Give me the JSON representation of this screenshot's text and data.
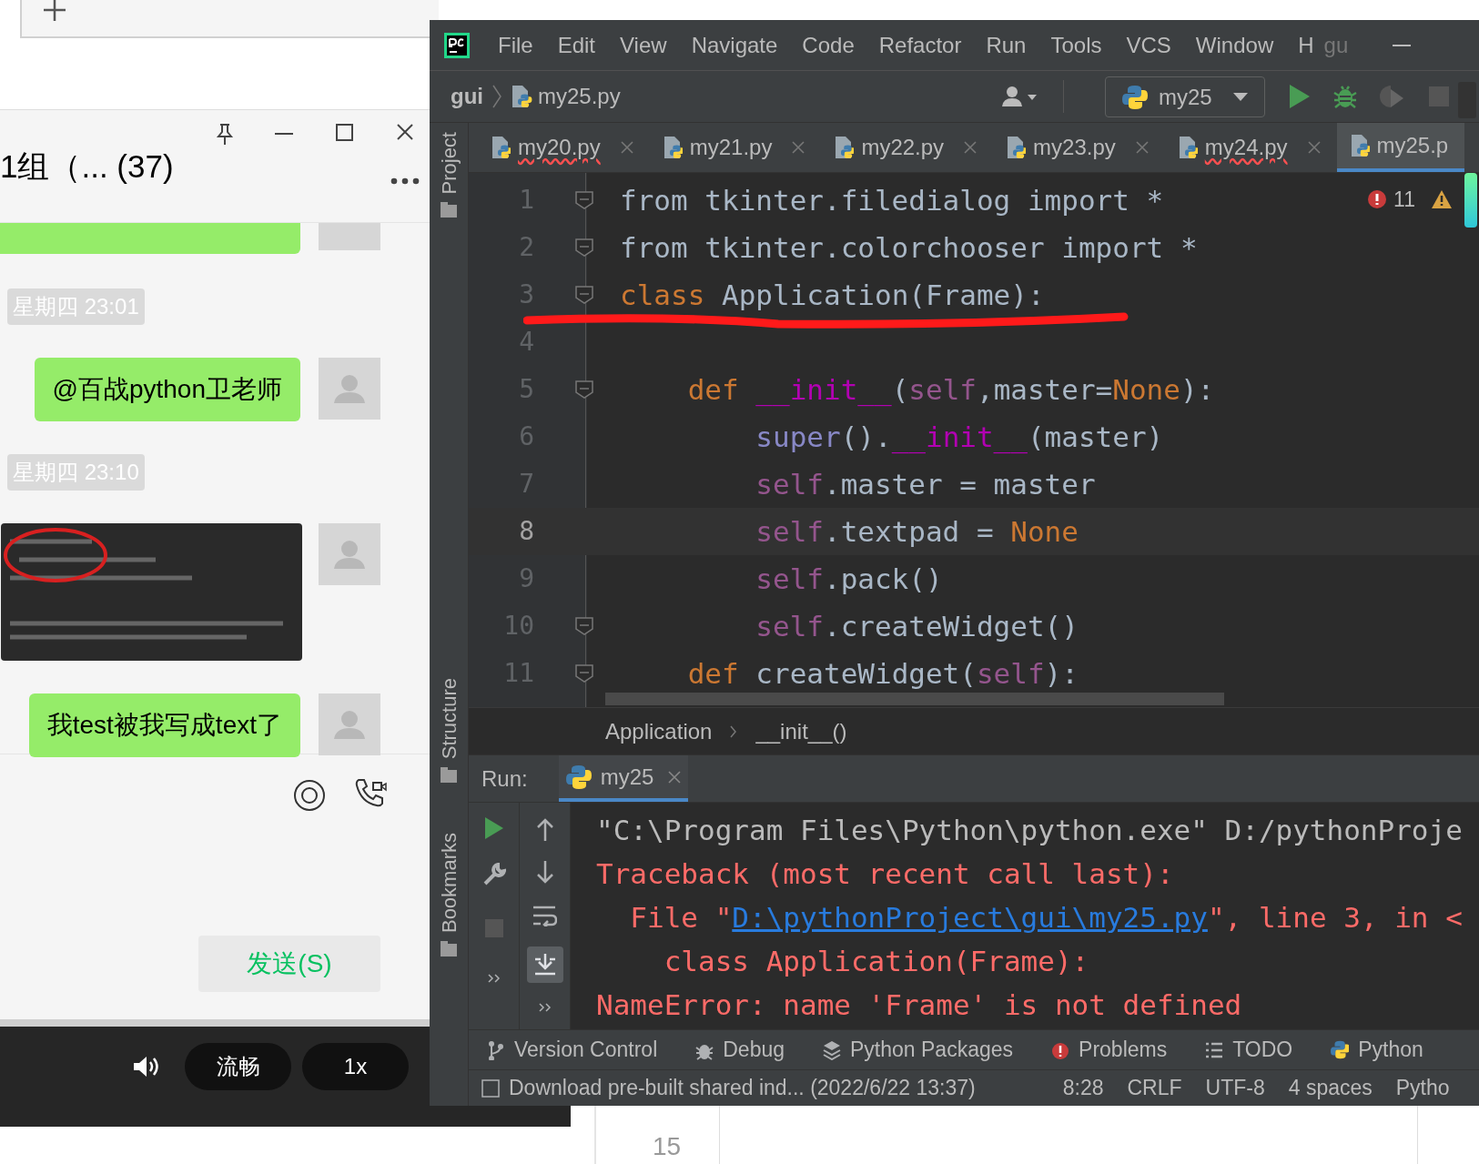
{
  "chat": {
    "title": "1组（... (37)",
    "messages": [
      {
        "kind": "time",
        "text": "星期四 23:01"
      },
      {
        "kind": "text",
        "text": "@百战python卫老师"
      },
      {
        "kind": "time",
        "text": "星期四 23:10"
      },
      {
        "kind": "image"
      },
      {
        "kind": "text",
        "text": "我test被我写成text了"
      }
    ],
    "send_button": "发送(S)"
  },
  "player": {
    "quality": "流畅",
    "speed": "1x"
  },
  "ide": {
    "menu": [
      "File",
      "Edit",
      "View",
      "Navigate",
      "Code",
      "Refactor",
      "Run",
      "Tools",
      "VCS",
      "Window",
      "H"
    ],
    "window_title": "gu",
    "breadcrumb": {
      "project": "gui",
      "file": "my25.py"
    },
    "run_config": "my25",
    "tabs": [
      {
        "label": "my20.py",
        "selected": false,
        "has_error": true
      },
      {
        "label": "my21.py",
        "selected": false,
        "has_error": false
      },
      {
        "label": "my22.py",
        "selected": false,
        "has_error": false
      },
      {
        "label": "my23.py",
        "selected": false,
        "has_error": false
      },
      {
        "label": "my24.py",
        "selected": false,
        "has_error": true
      },
      {
        "label": "my25.p",
        "selected": true,
        "has_error": false
      }
    ],
    "side_tools": [
      "Project",
      "Structure",
      "Bookmarks"
    ],
    "inspections": {
      "errors": "11"
    },
    "code": [
      {
        "number": "1",
        "fold": true,
        "current": false,
        "tokens": [
          {
            "kind": "plain",
            "text": "from tkinter.filedialog import *"
          }
        ]
      },
      {
        "number": "2",
        "fold": true,
        "current": false,
        "tokens": [
          {
            "kind": "plain",
            "text": "from tkinter.colorchooser import *"
          }
        ]
      },
      {
        "number": "3",
        "fold": true,
        "current": false,
        "tokens": [
          {
            "kind": "keyword",
            "text": "class"
          },
          {
            "kind": "plain",
            "text": " Application(Frame):"
          }
        ]
      },
      {
        "number": "4",
        "fold": false,
        "current": false
      },
      {
        "number": "5",
        "fold": true,
        "current": false,
        "tokens": [
          {
            "kind": "keyword",
            "text": "    def"
          },
          {
            "kind": "dunder",
            "text": " __init__"
          },
          {
            "kind": "plain",
            "text": "("
          },
          {
            "kind": "self",
            "text": "self"
          },
          {
            "kind": "plain",
            "text": ",master="
          },
          {
            "kind": "keyword",
            "text": "None"
          },
          {
            "kind": "plain",
            "text": "):"
          }
        ]
      },
      {
        "number": "6",
        "fold": false,
        "current": false,
        "tokens": [
          {
            "kind": "builtin",
            "text": "        super"
          },
          {
            "kind": "plain",
            "text": "()."
          },
          {
            "kind": "dunder",
            "text": "__init__"
          },
          {
            "kind": "plain",
            "text": "(master)"
          }
        ]
      },
      {
        "number": "7",
        "fold": false,
        "current": false,
        "tokens": [
          {
            "kind": "self",
            "text": "        self"
          },
          {
            "kind": "plain",
            "text": ".master = master"
          }
        ]
      },
      {
        "number": "8",
        "fold": false,
        "current": true,
        "tokens": [
          {
            "kind": "self",
            "text": "        self"
          },
          {
            "kind": "plain",
            "text": ".textpad = "
          },
          {
            "kind": "keyword",
            "text": "None"
          }
        ]
      },
      {
        "number": "9",
        "fold": false,
        "current": false,
        "tokens": [
          {
            "kind": "self",
            "text": "        self"
          },
          {
            "kind": "plain",
            "text": ".pack()"
          }
        ]
      },
      {
        "number": "10",
        "fold": true,
        "current": false,
        "tokens": [
          {
            "kind": "self",
            "text": "        self"
          },
          {
            "kind": "plain",
            "text": ".createWidget()"
          }
        ]
      },
      {
        "number": "11",
        "fold": true,
        "current": false,
        "tokens": [
          {
            "kind": "keyword",
            "text": "    def"
          },
          {
            "kind": "plain",
            "text": " createWidget("
          },
          {
            "kind": "self",
            "text": "self"
          },
          {
            "kind": "plain",
            "text": "):"
          }
        ]
      }
    ],
    "structure_path": [
      "Application",
      "__init__()"
    ],
    "run": {
      "label": "Run:",
      "tab": "my25",
      "output": [
        {
          "kind": "command",
          "parts": [
            {
              "kind": "text",
              "text": "\"C:\\Program Files\\Python\\python.exe\" D:/pythonProje"
            }
          ]
        },
        {
          "kind": "error",
          "parts": [
            {
              "kind": "text",
              "text": "Traceback (most recent call last):"
            }
          ]
        },
        {
          "kind": "error",
          "parts": [
            {
              "kind": "text",
              "text": "  File \""
            },
            {
              "kind": "link",
              "text": "D:\\pythonProject\\gui\\my25.py"
            },
            {
              "kind": "text",
              "text": "\", line 3, in <"
            }
          ]
        },
        {
          "kind": "error",
          "parts": [
            {
              "kind": "text",
              "text": "    class Application(Frame):"
            }
          ]
        },
        {
          "kind": "error",
          "parts": [
            {
              "kind": "text",
              "text": "NameError: name 'Frame' is not defined"
            }
          ]
        }
      ]
    },
    "tool_windows": [
      {
        "kind": "vcs",
        "label": "Version Control"
      },
      {
        "kind": "debug",
        "label": "Debug"
      },
      {
        "kind": "packages",
        "label": "Python Packages"
      },
      {
        "kind": "problems",
        "label": "Problems"
      },
      {
        "kind": "todo",
        "label": "TODO"
      },
      {
        "kind": "python",
        "label": "Python"
      }
    ],
    "status": {
      "message": "Download pre-built shared ind... (2022/6/22 13:37)",
      "items": [
        "8:28",
        "CRLF",
        "UTF-8",
        "4 spaces",
        "Pytho"
      ]
    }
  },
  "background_editor": {
    "line_number": "15"
  }
}
